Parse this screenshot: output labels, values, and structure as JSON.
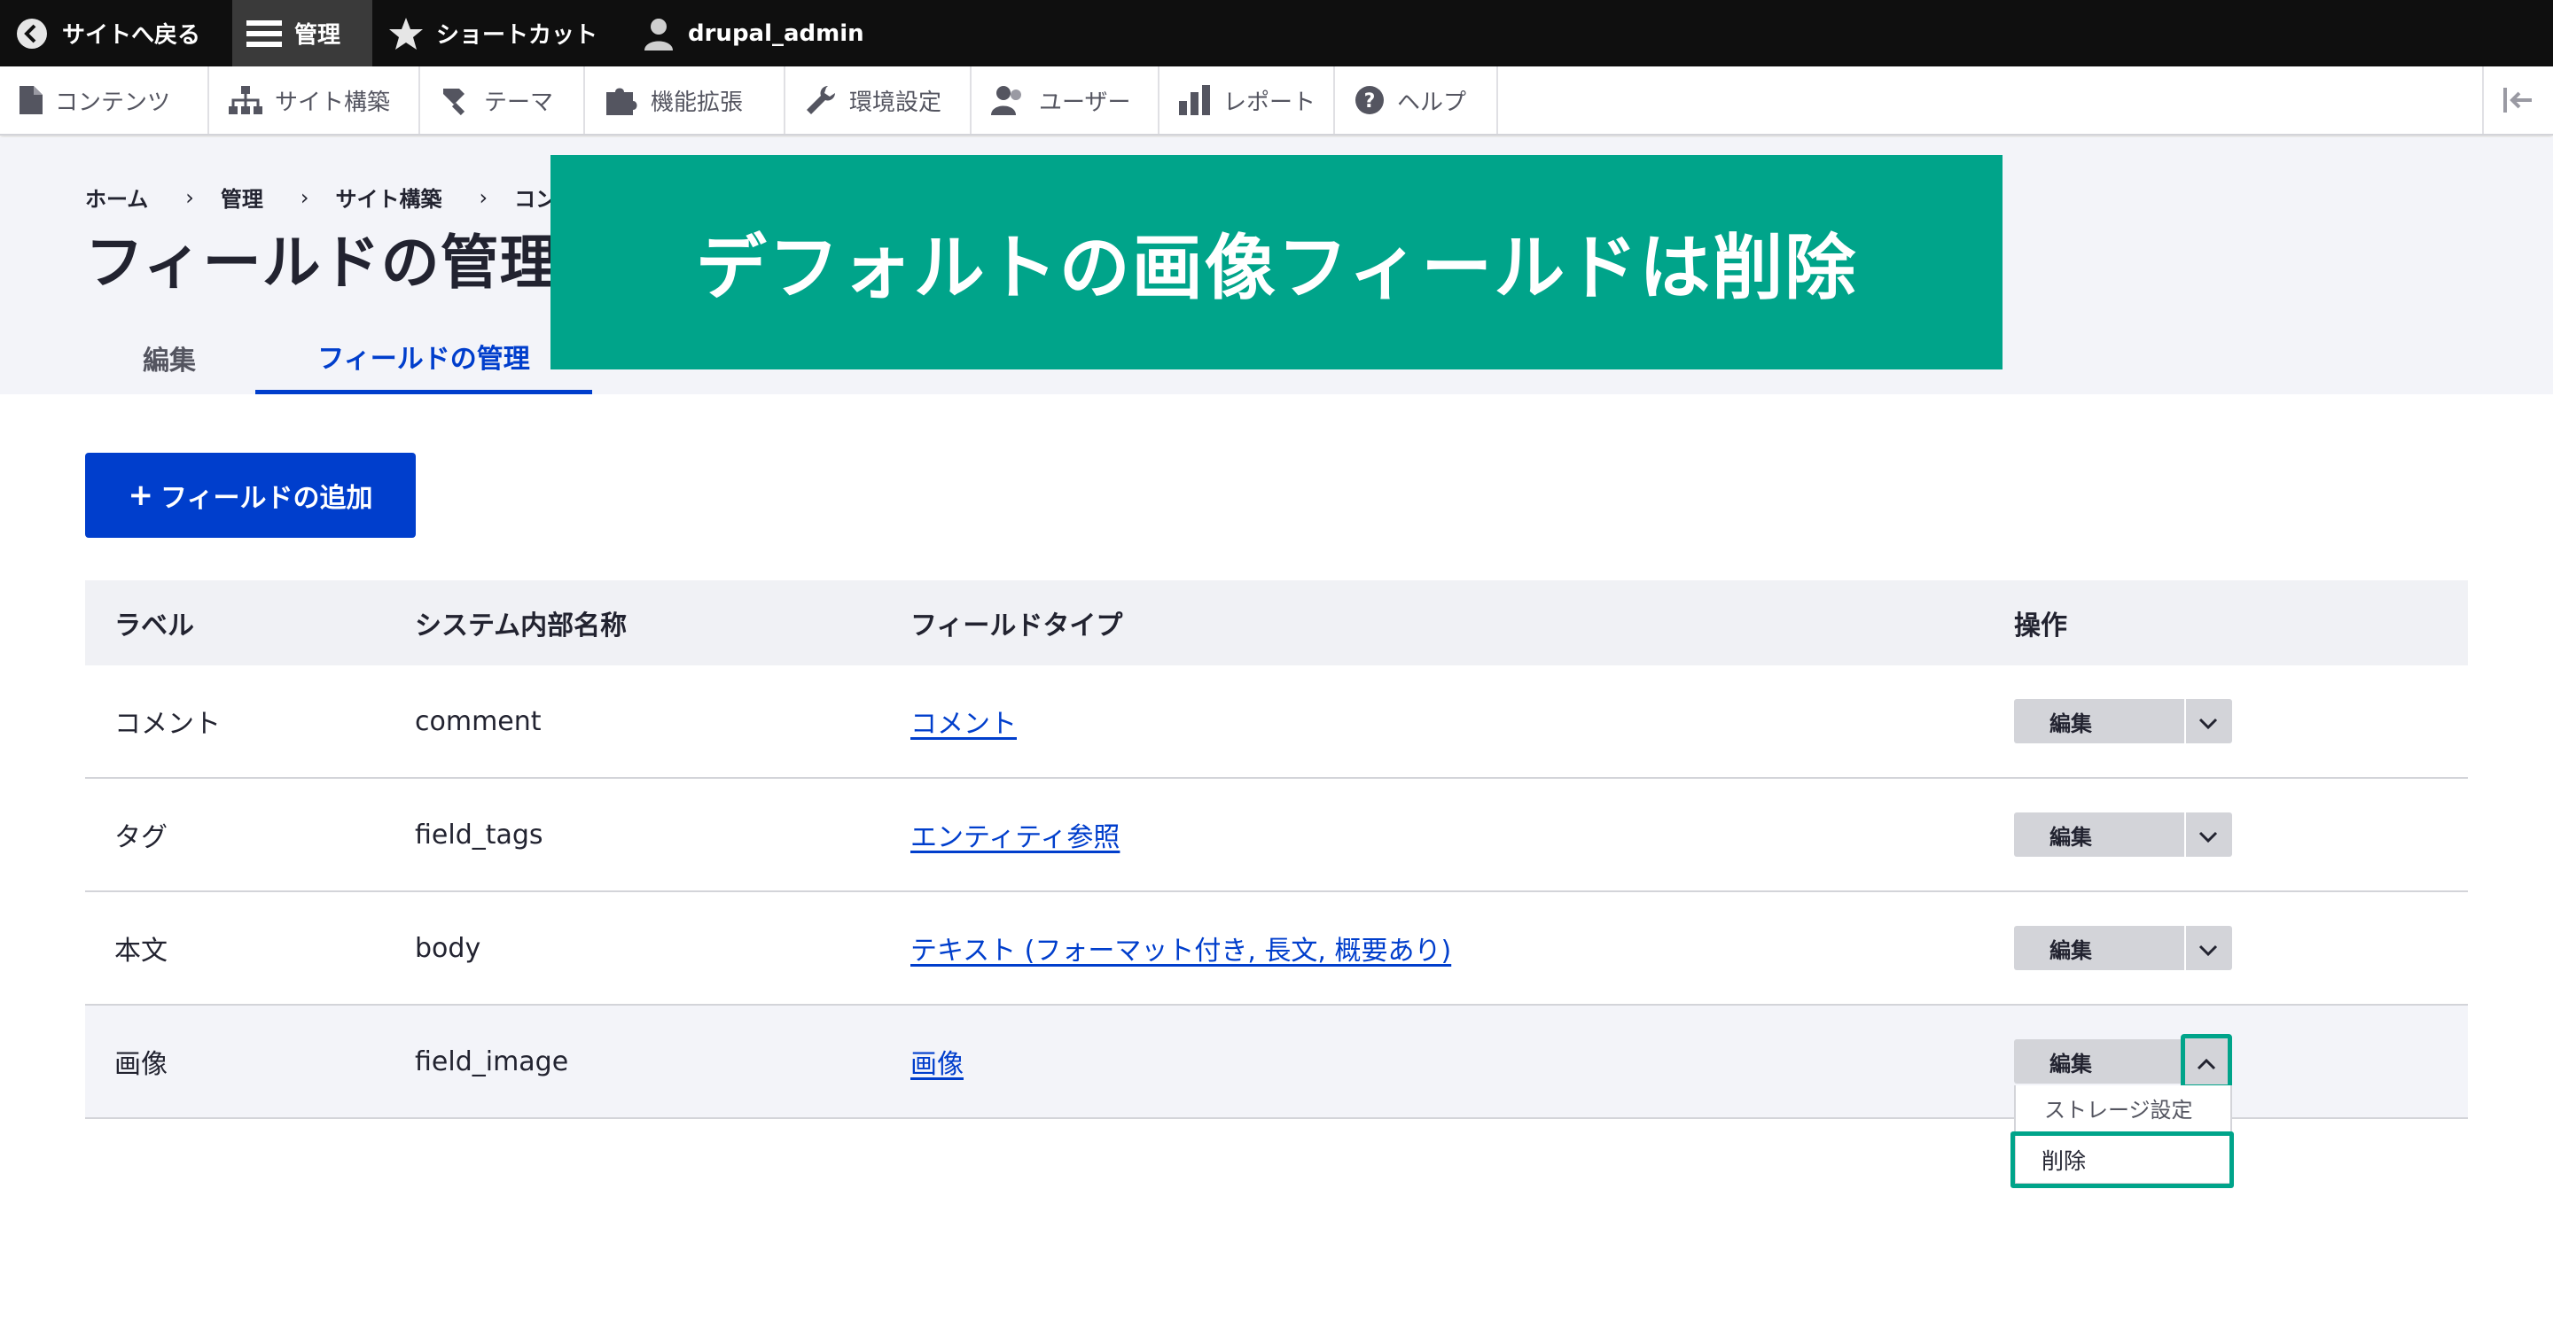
{
  "toolbar": {
    "back": "サイトへ戻る",
    "manage": "管理",
    "shortcuts": "ショートカット",
    "user": "drupal_admin"
  },
  "tray": {
    "items": [
      {
        "label": "コンテンツ",
        "icon": "file-icon"
      },
      {
        "label": "サイト構築",
        "icon": "sitemap-icon"
      },
      {
        "label": "テーマ",
        "icon": "paint-roller-icon"
      },
      {
        "label": "機能拡張",
        "icon": "puzzle-icon"
      },
      {
        "label": "環境設定",
        "icon": "wrench-icon"
      },
      {
        "label": "ユーザー",
        "icon": "people-icon"
      },
      {
        "label": "レポート",
        "icon": "bar-chart-icon"
      },
      {
        "label": "ヘルプ",
        "icon": "help-icon"
      }
    ]
  },
  "breadcrumb": [
    "ホーム",
    "管理",
    "サイト構築",
    "コンテ"
  ],
  "page_title": "フィールドの管理",
  "tabs": {
    "edit": "編集",
    "fields": "フィールドの管理"
  },
  "banner": "デフォルトの画像フィールドは削除",
  "add_button": {
    "plus": "+",
    "label": "フィールドの追加"
  },
  "table": {
    "headers": [
      "ラベル",
      "システム内部名称",
      "フィールドタイプ",
      "操作"
    ],
    "rows": [
      {
        "label": "コメント",
        "machine": "comment",
        "type": "コメント",
        "op": "編集"
      },
      {
        "label": "タグ",
        "machine": "field_tags",
        "type": "エンティティ参照",
        "op": "編集"
      },
      {
        "label": "本文",
        "machine": "body",
        "type": "テキスト (フォーマット付き, 長文, 概要あり)",
        "op": "編集"
      },
      {
        "label": "画像",
        "machine": "field_image",
        "type": "画像",
        "op": "編集"
      }
    ]
  },
  "dropdown": {
    "storage": "ストレージ設定",
    "delete": "削除"
  },
  "colors": {
    "accent": "#003ecc",
    "highlight": "#00a48a",
    "toolbar": "#0f0f0f"
  }
}
